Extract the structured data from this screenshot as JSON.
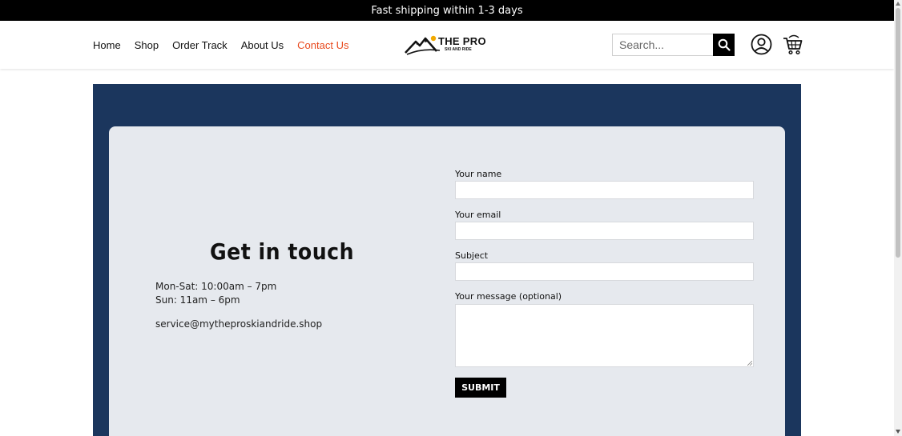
{
  "announcement": "Fast shipping within 1-3 days",
  "nav": {
    "items": [
      {
        "label": "Home"
      },
      {
        "label": "Shop"
      },
      {
        "label": "Order Track"
      },
      {
        "label": "About Us"
      },
      {
        "label": "Contact Us"
      }
    ],
    "active_color": "#e8491d"
  },
  "logo": {
    "text": "THE PRO",
    "subtext": "SKI AND RIDE"
  },
  "search": {
    "placeholder": "Search..."
  },
  "icons": {
    "search": "search-icon",
    "account": "user-icon",
    "cart": "cart-icon"
  },
  "contact": {
    "title": "Get in touch",
    "hours_weekday": "Mon-Sat: 10:00am – 7pm",
    "hours_weekend": "Sun: 11am – 6pm",
    "email": "service@mytheproskiandride.shop"
  },
  "form": {
    "name_label": "Your name",
    "email_label": "Your email",
    "subject_label": "Subject",
    "message_label": "Your message (optional)",
    "submit_label": "SUBMIT"
  },
  "colors": {
    "section_bg": "#1b365d",
    "card_bg": "#e6e9ee",
    "announcement_bg": "#000000"
  }
}
